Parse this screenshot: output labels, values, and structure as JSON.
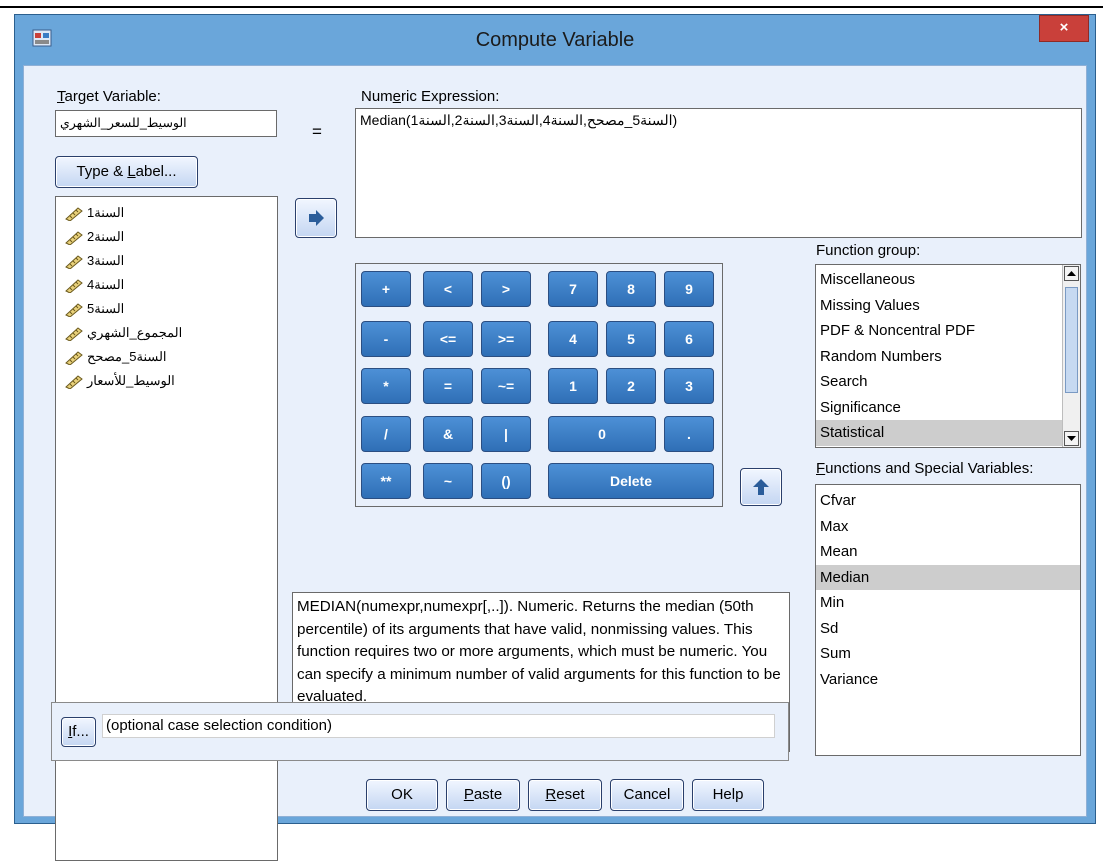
{
  "window": {
    "title": "Compute Variable",
    "close_label": "×"
  },
  "target": {
    "label_prefix": "",
    "label_u": "T",
    "label_rest": "arget Variable:",
    "value": "الوسيط_للسعر_الشهري"
  },
  "type_label_button": {
    "pre": "Type & ",
    "u": "L",
    "post": "abel..."
  },
  "equals": "=",
  "numeric": {
    "label_pre": "Num",
    "label_u": "e",
    "label_post": "ric Expression:",
    "value": "Median(السنة5_مصحح,السنة4,السنة3,السنة2,السنة1)"
  },
  "variables": [
    "السنة1",
    "السنة2",
    "السنة3",
    "السنة4",
    "السنة5",
    "المجموع_الشهري",
    "السنة5_مصحح",
    "الوسيط_للأسعار"
  ],
  "keypad": {
    "row1": [
      "+",
      "<",
      ">",
      "7",
      "8",
      "9"
    ],
    "row2": [
      "-",
      "<=",
      ">=",
      "4",
      "5",
      "6"
    ],
    "row3": [
      "*",
      "=",
      "~=",
      "1",
      "2",
      "3"
    ],
    "row4": [
      "/",
      "&",
      "|",
      "0",
      "."
    ],
    "row5": [
      "**",
      "~",
      "()",
      "Delete"
    ]
  },
  "function_group": {
    "label_pre": "Function ",
    "label_u": "g",
    "label_post": "roup:",
    "items": [
      "Miscellaneous",
      "Missing Values",
      "PDF & Noncentral PDF",
      "Random Numbers",
      "Search",
      "Significance",
      "Statistical"
    ],
    "selected": "Statistical"
  },
  "functions": {
    "label_pre": "",
    "label_u": "F",
    "label_post": "unctions and Special Variables:",
    "items": [
      "Cfvar",
      "Max",
      "Mean",
      "Median",
      "Min",
      "Sd",
      "Sum",
      "Variance"
    ],
    "selected": "Median"
  },
  "description": "MEDIAN(numexpr,numexpr[,..]). Numeric. Returns the median (50th percentile) of its arguments that have valid, nonmissing values. This function requires two or more arguments, which must be numeric. You can specify a minimum number of valid arguments for this function to be evaluated.",
  "if_button": {
    "u": "I",
    "rest": "f..."
  },
  "if_condition": "(optional case selection condition)",
  "buttons": {
    "ok": "OK",
    "paste_u": "P",
    "paste_rest": "aste",
    "reset_u": "R",
    "reset_rest": "eset",
    "cancel": "Cancel",
    "help": "Help"
  },
  "colors": {
    "title_bar": "#6aa6da",
    "dialog_bg": "#e9f0fb",
    "keypad_button": "#3a7cc4",
    "close_button": "#c9403a",
    "selection": "#cdcdcd"
  },
  "icons": [
    "app-icon",
    "ruler-icon",
    "arrow-right-icon",
    "arrow-up-icon",
    "scroll-up-icon",
    "scroll-down-icon"
  ]
}
